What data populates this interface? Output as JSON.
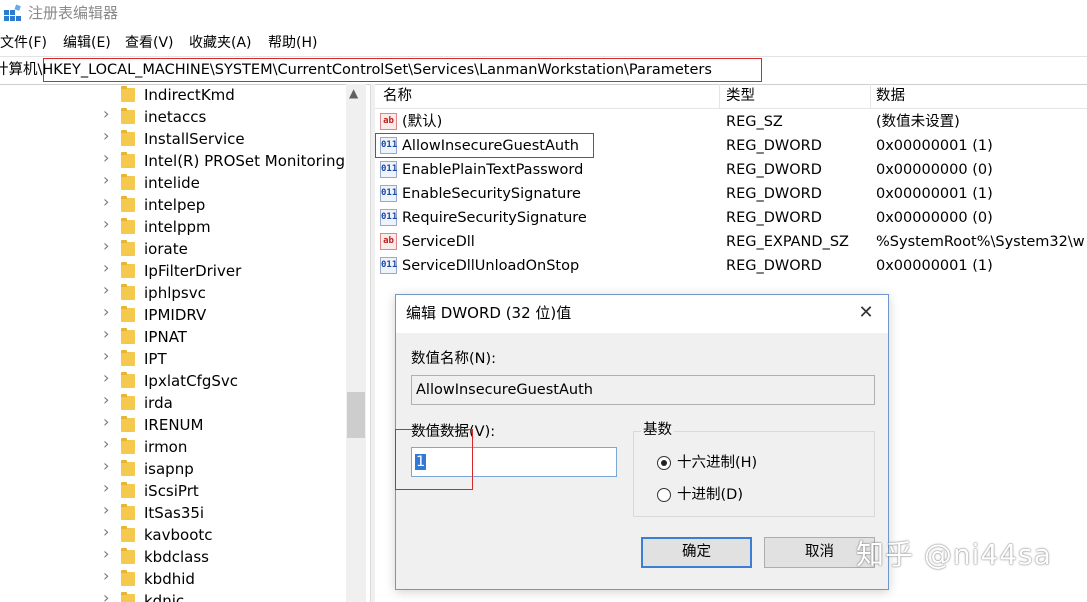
{
  "window": {
    "title": "注册表编辑器",
    "icon": "regedit-icon"
  },
  "menu": [
    "文件(F)",
    "编辑(E)",
    "查看(V)",
    "收藏夹(A)",
    "帮助(H)"
  ],
  "address": {
    "prefix": "计算机",
    "path": "\\HKEY_LOCAL_MACHINE\\SYSTEM\\CurrentControlSet\\Services\\LanmanWorkstation\\Parameters"
  },
  "tree": {
    "items": [
      {
        "label": "IndirectKmd",
        "expandable": false
      },
      {
        "label": "inetaccs",
        "expandable": true
      },
      {
        "label": "InstallService",
        "expandable": true
      },
      {
        "label": "Intel(R) PROSet Monitoring",
        "expandable": true
      },
      {
        "label": "intelide",
        "expandable": true
      },
      {
        "label": "intelpep",
        "expandable": true
      },
      {
        "label": "intelppm",
        "expandable": true
      },
      {
        "label": "iorate",
        "expandable": true
      },
      {
        "label": "IpFilterDriver",
        "expandable": true
      },
      {
        "label": "iphlpsvc",
        "expandable": true
      },
      {
        "label": "IPMIDRV",
        "expandable": true
      },
      {
        "label": "IPNAT",
        "expandable": true
      },
      {
        "label": "IPT",
        "expandable": true
      },
      {
        "label": "IpxlatCfgSvc",
        "expandable": true
      },
      {
        "label": "irda",
        "expandable": true
      },
      {
        "label": "IRENUM",
        "expandable": true
      },
      {
        "label": "irmon",
        "expandable": true
      },
      {
        "label": "isapnp",
        "expandable": true
      },
      {
        "label": "iScsiPrt",
        "expandable": true
      },
      {
        "label": "ItSas35i",
        "expandable": true
      },
      {
        "label": "kavbootc",
        "expandable": true
      },
      {
        "label": "kbdclass",
        "expandable": true
      },
      {
        "label": "kbdhid",
        "expandable": true
      },
      {
        "label": "kdnic",
        "expandable": true
      }
    ]
  },
  "list": {
    "columns": {
      "name": "名称",
      "type": "类型",
      "data": "数据"
    },
    "rows": [
      {
        "icon": "string-value-icon",
        "name": "(默认)",
        "type": "REG_SZ",
        "data": "(数值未设置)"
      },
      {
        "icon": "binary-value-icon",
        "name": "AllowInsecureGuestAuth",
        "type": "REG_DWORD",
        "data": "0x00000001 (1)"
      },
      {
        "icon": "binary-value-icon",
        "name": "EnablePlainTextPassword",
        "type": "REG_DWORD",
        "data": "0x00000000 (0)"
      },
      {
        "icon": "binary-value-icon",
        "name": "EnableSecuritySignature",
        "type": "REG_DWORD",
        "data": "0x00000001 (1)"
      },
      {
        "icon": "binary-value-icon",
        "name": "RequireSecuritySignature",
        "type": "REG_DWORD",
        "data": "0x00000000 (0)"
      },
      {
        "icon": "string-value-icon",
        "name": "ServiceDll",
        "type": "REG_EXPAND_SZ",
        "data": "%SystemRoot%\\System32\\w"
      },
      {
        "icon": "binary-value-icon",
        "name": "ServiceDllUnloadOnStop",
        "type": "REG_DWORD",
        "data": "0x00000001 (1)"
      }
    ]
  },
  "dialog": {
    "title": "编辑 DWORD (32 位)值",
    "name_label": "数值名称(N):",
    "name_value": "AllowInsecureGuestAuth",
    "data_label": "数值数据(V):",
    "data_value": "1",
    "base_label": "基数",
    "hex_label": "十六进制(H)",
    "dec_label": "十进制(D)",
    "selected_base": "hex",
    "ok_label": "确定",
    "cancel_label": "取消"
  },
  "watermark": "知乎 @ni44sa",
  "colors": {
    "highlight_border": "#d9262b",
    "selection": "#3377d8",
    "folder": "#f4c94e"
  }
}
